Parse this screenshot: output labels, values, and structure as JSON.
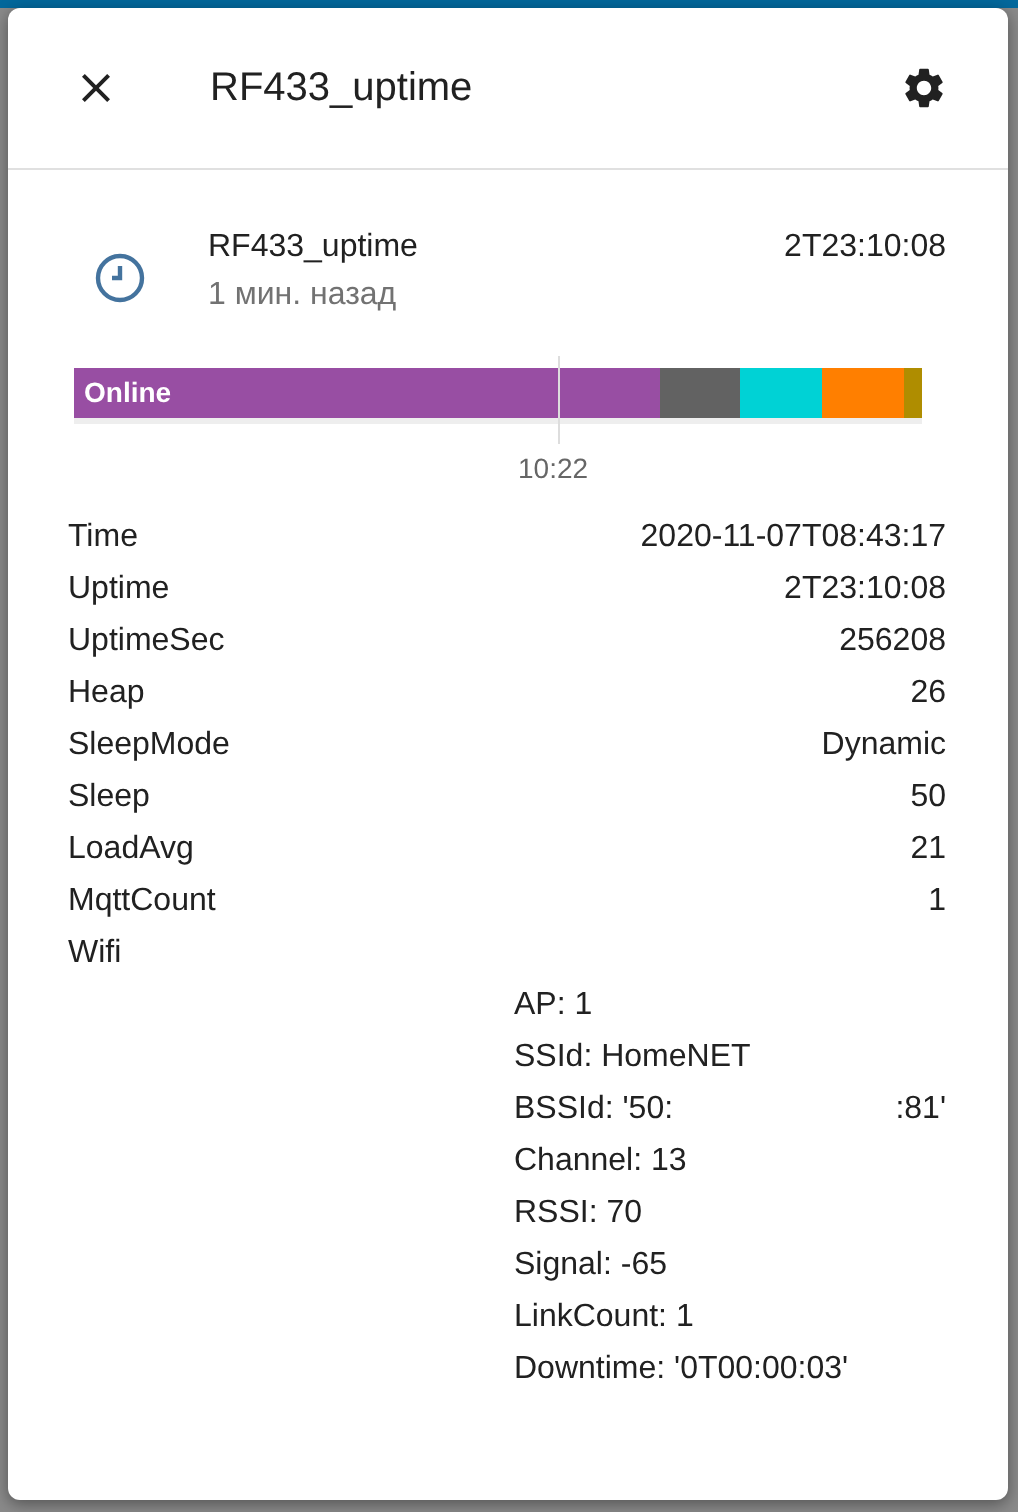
{
  "dialog": {
    "title": "RF433_uptime"
  },
  "entity": {
    "name": "RF433_uptime",
    "last_changed": "1 мин. назад",
    "state": "2T23:10:08"
  },
  "timeline": {
    "segments": [
      {
        "label": "Online",
        "color": "#984ea3"
      },
      {
        "color": "#626262"
      },
      {
        "color": "#00d2d5"
      },
      {
        "color": "#ff7f00"
      },
      {
        "color": "#af8d00"
      }
    ],
    "tick": "10:22"
  },
  "attributes": [
    {
      "name": "Time",
      "value": "2020-11-07T08:43:17"
    },
    {
      "name": "Uptime",
      "value": "2T23:10:08"
    },
    {
      "name": "UptimeSec",
      "value": "256208"
    },
    {
      "name": "Heap",
      "value": "26"
    },
    {
      "name": "SleepMode",
      "value": "Dynamic"
    },
    {
      "name": "Sleep",
      "value": "50"
    },
    {
      "name": "LoadAvg",
      "value": "21"
    },
    {
      "name": "MqttCount",
      "value": "1"
    }
  ],
  "wifi": {
    "name": "Wifi",
    "lines": [
      {
        "text": "AP: 1"
      },
      {
        "text": "SSId: HomeNET"
      },
      {
        "text": "BSSId: '50:",
        "tail": ":81'"
      },
      {
        "text": "Channel: 13"
      },
      {
        "text": "RSSI: 70"
      },
      {
        "text": "Signal: -65"
      },
      {
        "text": "LinkCount: 1"
      },
      {
        "text": "Downtime: '0T00:00:03'"
      }
    ]
  }
}
